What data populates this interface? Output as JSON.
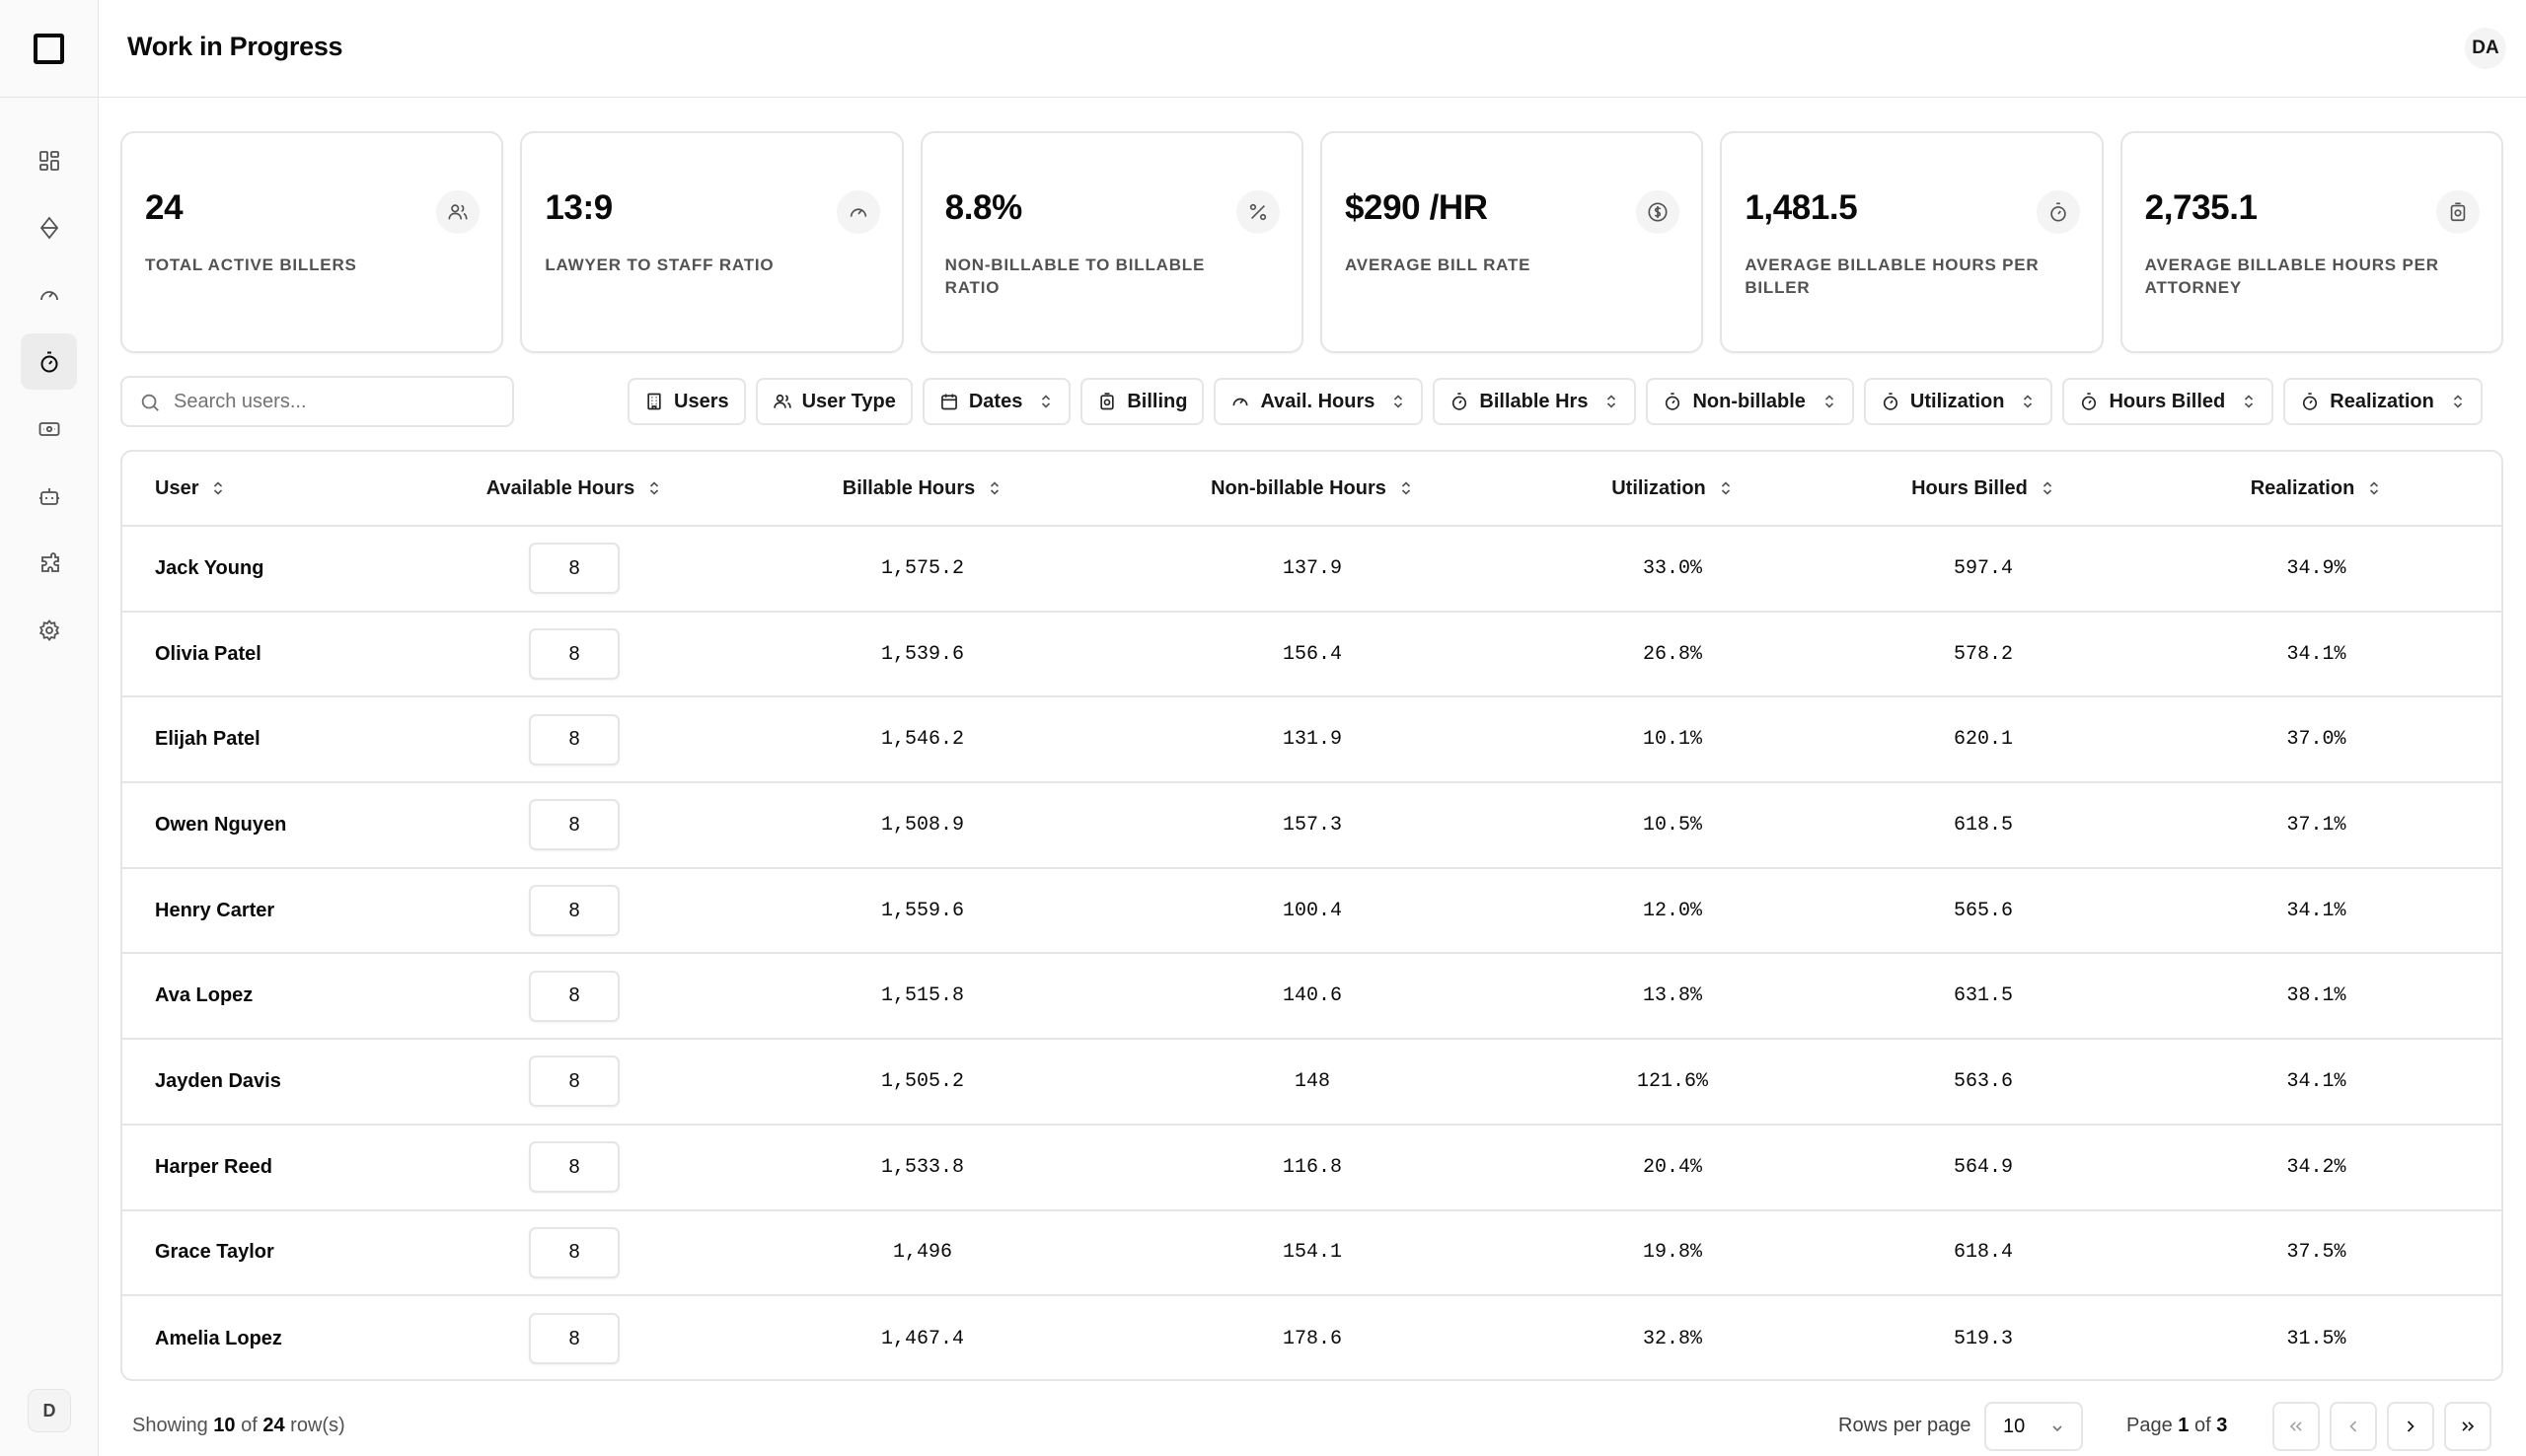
{
  "header": {
    "title": "Work in Progress",
    "avatar": "DA"
  },
  "sidebar": {
    "items": [
      {
        "icon": "dashboard-icon"
      },
      {
        "icon": "diamond-icon"
      },
      {
        "icon": "gauge-icon"
      },
      {
        "icon": "timer-icon",
        "active": true
      },
      {
        "icon": "banknote-icon"
      },
      {
        "icon": "bot-icon"
      },
      {
        "icon": "puzzle-icon"
      },
      {
        "icon": "settings-icon"
      }
    ],
    "user_initial": "D"
  },
  "stats": [
    {
      "value": "24",
      "label": "TOTAL ACTIVE BILLERS",
      "icon": "users-icon"
    },
    {
      "value": "13:9",
      "label": "LAWYER TO STAFF RATIO",
      "icon": "gauge-icon"
    },
    {
      "value": "8.8%",
      "label": "NON-BILLABLE TO BILLABLE RATIO",
      "icon": "percent-icon"
    },
    {
      "value": "$290 /HR",
      "label": "AVERAGE BILL RATE",
      "icon": "dollar-icon"
    },
    {
      "value": "1,481.5",
      "label": "AVERAGE BILLABLE HOURS PER BILLER",
      "icon": "timer-icon"
    },
    {
      "value": "2,735.1",
      "label": "AVERAGE BILLABLE HOURS PER ATTORNEY",
      "icon": "money-icon"
    }
  ],
  "search": {
    "placeholder": "Search users..."
  },
  "filters": [
    {
      "label": "Users"
    },
    {
      "label": "User Type"
    },
    {
      "label": "Dates"
    },
    {
      "label": "Billing"
    },
    {
      "label": "Avail. Hours"
    },
    {
      "label": "Billable Hrs"
    },
    {
      "label": "Non-billable"
    },
    {
      "label": "Utilization"
    },
    {
      "label": "Hours Billed"
    },
    {
      "label": "Realization"
    }
  ],
  "table": {
    "columns": [
      "User",
      "Available Hours",
      "Billable Hours",
      "Non-billable Hours",
      "Utilization",
      "Hours Billed",
      "Realization"
    ],
    "rows": [
      {
        "user": "Jack Young",
        "available": "8",
        "billable": "1,575.2",
        "nonbillable": "137.9",
        "utilization": "33.0%",
        "billed": "597.4",
        "realization": "34.9%"
      },
      {
        "user": "Olivia Patel",
        "available": "8",
        "billable": "1,539.6",
        "nonbillable": "156.4",
        "utilization": "26.8%",
        "billed": "578.2",
        "realization": "34.1%"
      },
      {
        "user": "Elijah Patel",
        "available": "8",
        "billable": "1,546.2",
        "nonbillable": "131.9",
        "utilization": "10.1%",
        "billed": "620.1",
        "realization": "37.0%"
      },
      {
        "user": "Owen Nguyen",
        "available": "8",
        "billable": "1,508.9",
        "nonbillable": "157.3",
        "utilization": "10.5%",
        "billed": "618.5",
        "realization": "37.1%"
      },
      {
        "user": "Henry Carter",
        "available": "8",
        "billable": "1,559.6",
        "nonbillable": "100.4",
        "utilization": "12.0%",
        "billed": "565.6",
        "realization": "34.1%"
      },
      {
        "user": "Ava Lopez",
        "available": "8",
        "billable": "1,515.8",
        "nonbillable": "140.6",
        "utilization": "13.8%",
        "billed": "631.5",
        "realization": "38.1%"
      },
      {
        "user": "Jayden Davis",
        "available": "8",
        "billable": "1,505.2",
        "nonbillable": "148",
        "utilization": "121.6%",
        "billed": "563.6",
        "realization": "34.1%"
      },
      {
        "user": "Harper Reed",
        "available": "8",
        "billable": "1,533.8",
        "nonbillable": "116.8",
        "utilization": "20.4%",
        "billed": "564.9",
        "realization": "34.2%"
      },
      {
        "user": "Grace Taylor",
        "available": "8",
        "billable": "1,496",
        "nonbillable": "154.1",
        "utilization": "19.8%",
        "billed": "618.4",
        "realization": "37.5%"
      },
      {
        "user": "Amelia Lopez",
        "available": "8",
        "billable": "1,467.4",
        "nonbillable": "178.6",
        "utilization": "32.8%",
        "billed": "519.3",
        "realization": "31.5%"
      }
    ]
  },
  "footer": {
    "showing_prefix": "Showing",
    "shown": "10",
    "of_word": "of",
    "total": "24",
    "rows_suffix": "row(s)",
    "rows_per_page_label": "Rows per page",
    "rows_per_page": "10",
    "page_prefix": "Page",
    "page": "1",
    "page_total": "3"
  }
}
